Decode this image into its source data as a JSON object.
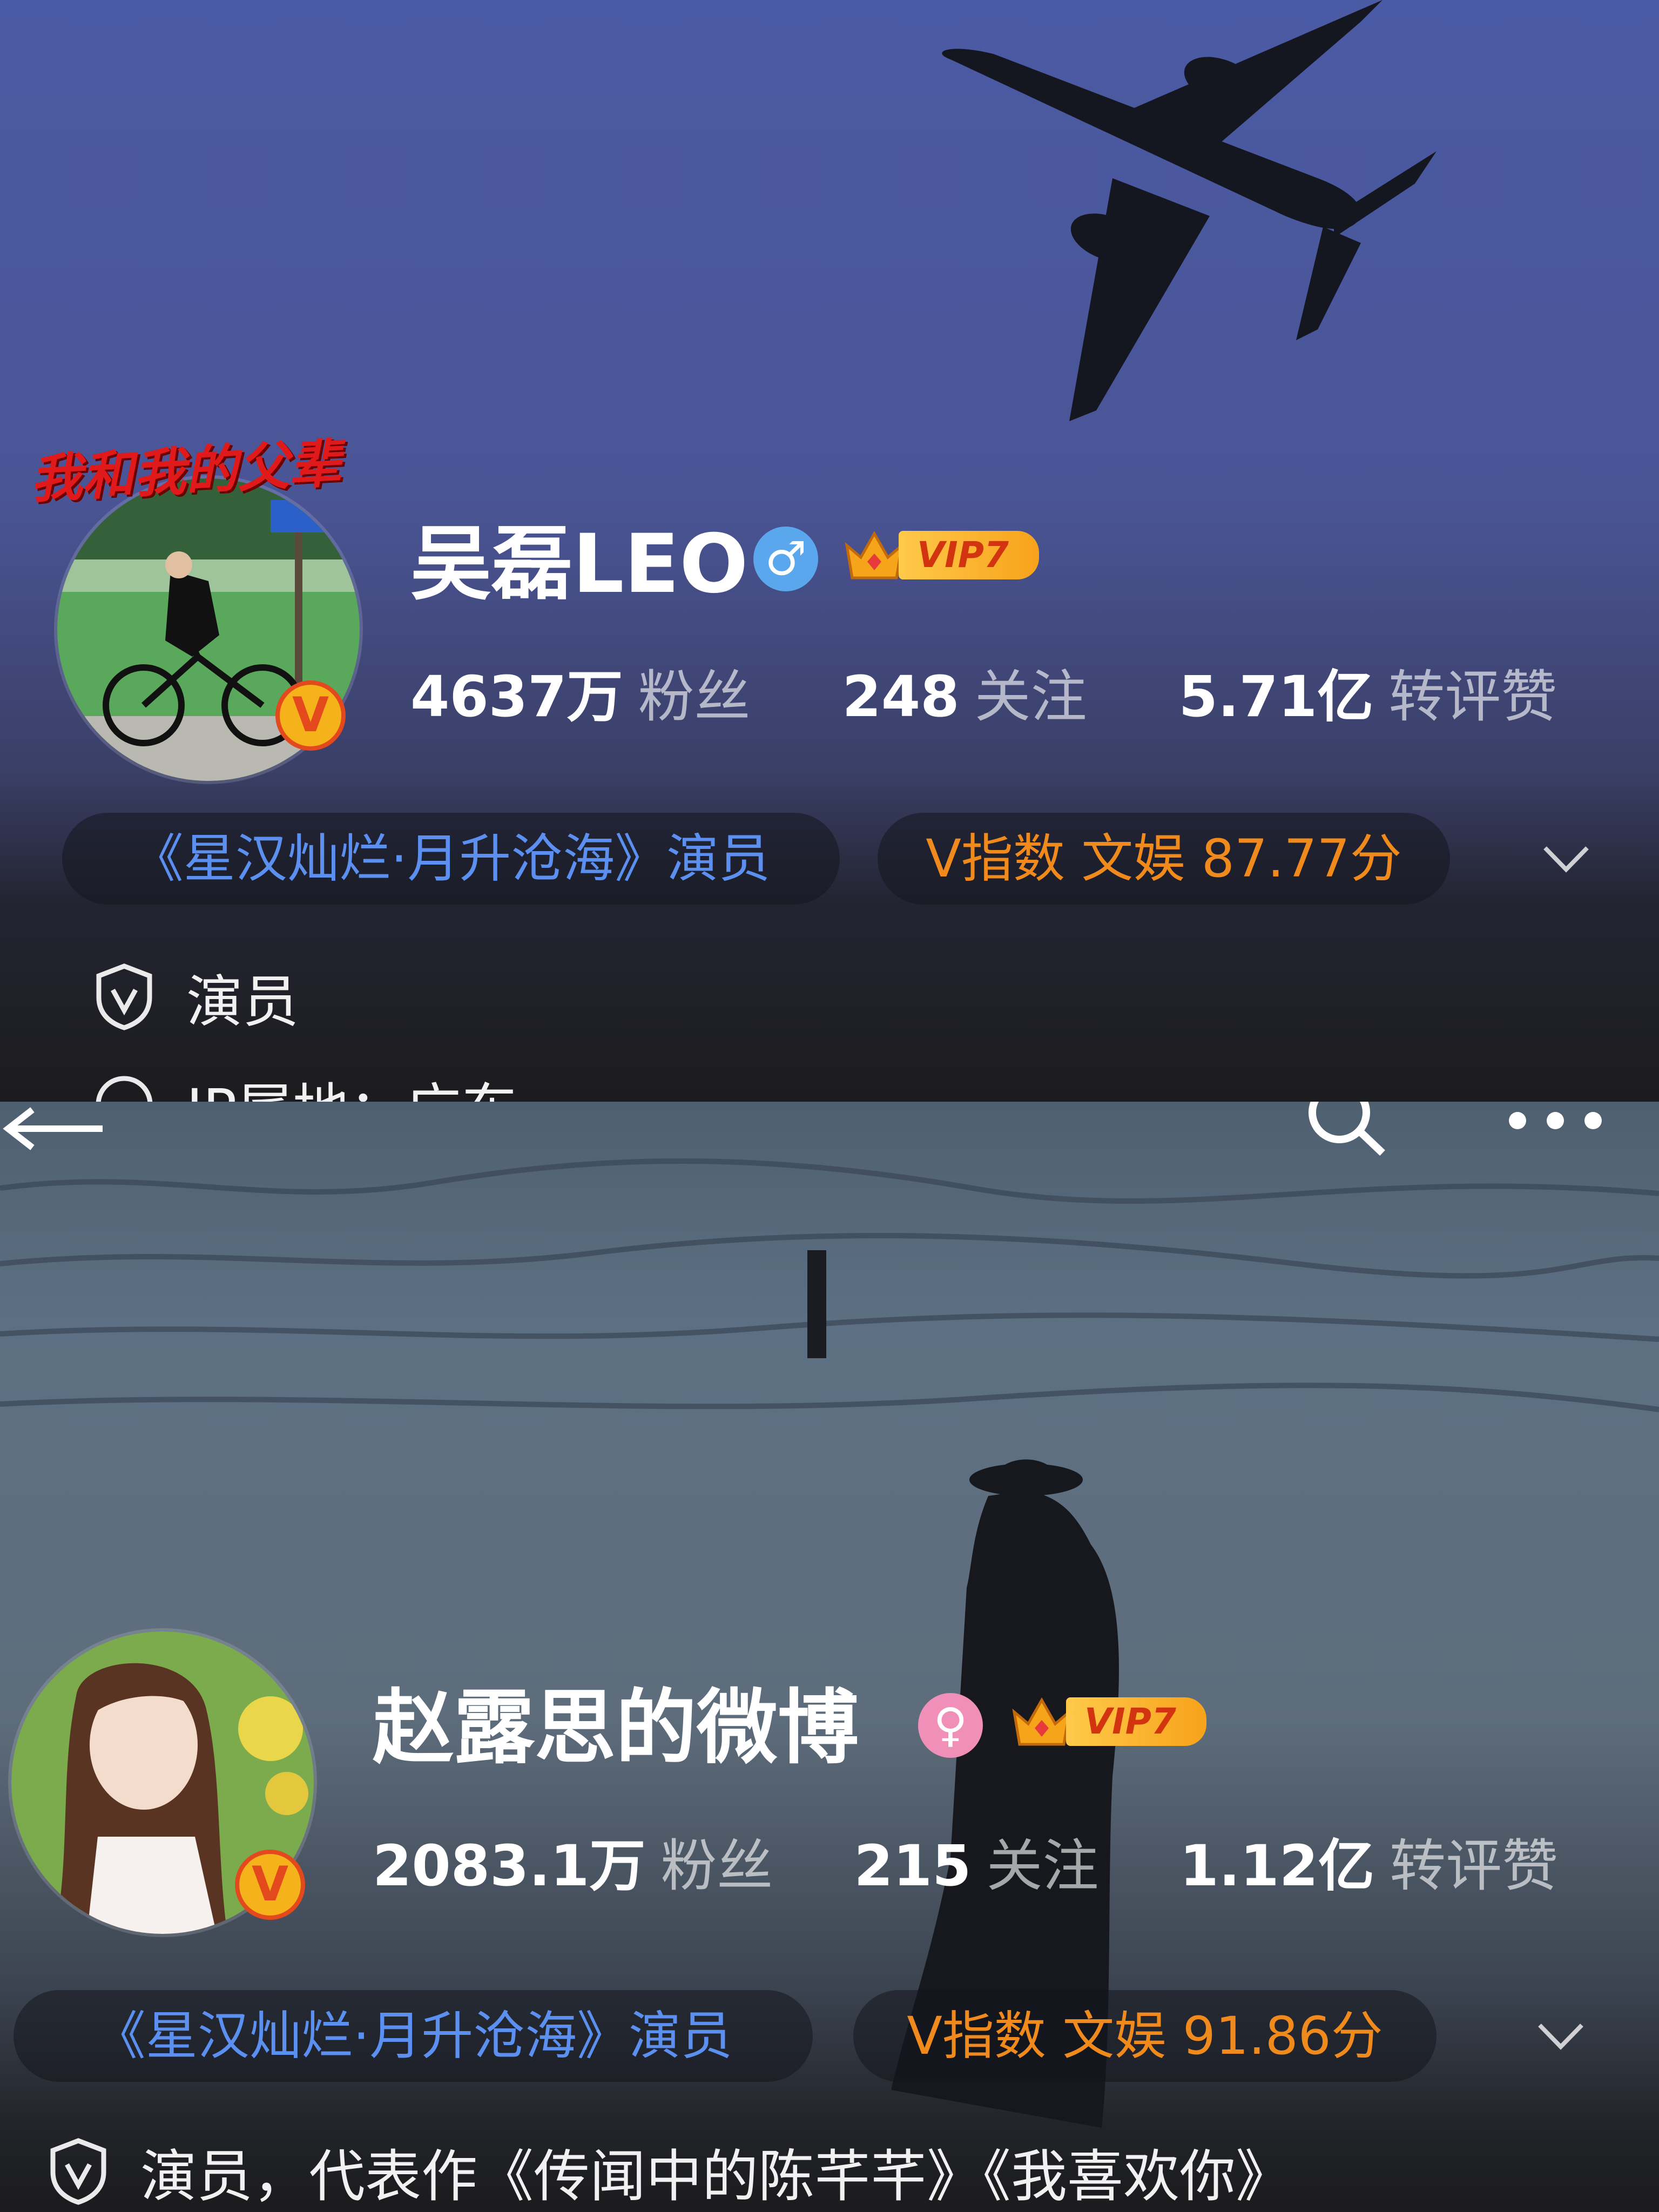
{
  "profiles": [
    {
      "name": "吴磊LEO",
      "gender_icon": "male-icon",
      "gender_symbol": "♂",
      "gender_color": "#5aa7ee",
      "vip_label": "VIP7",
      "avatar_overlay_text": "我和我的父辈",
      "stats": [
        {
          "value": "4637万",
          "label": "粉丝"
        },
        {
          "value": "248",
          "label": "关注"
        },
        {
          "value": "5.71亿",
          "label": "转评赞"
        }
      ],
      "tag": "《星汉灿烂·月升沧海》演员",
      "v_index": "V指数 文娱 87.77分",
      "verification": "演员",
      "ip_location": "IP属地：广东"
    },
    {
      "name": "赵露思的微博",
      "gender_icon": "female-icon",
      "gender_symbol": "♀",
      "gender_color": "#f08fb8",
      "vip_label": "VIP7",
      "stats": [
        {
          "value": "2083.1万",
          "label": "粉丝"
        },
        {
          "value": "215",
          "label": "关注"
        },
        {
          "value": "1.12亿",
          "label": "转评赞"
        }
      ],
      "tag": "《星汉灿烂·月升沧海》演员",
      "v_index": "V指数 文娱 91.86分",
      "verification": "演员，代表作《传闻中的陈芊芊》《我喜欢你》"
    }
  ],
  "colors": {
    "accent_blue": "#5b8ff0",
    "accent_orange": "#f08a1c",
    "verified_gold": "#f6b21a",
    "verified_red": "#e3491c"
  }
}
